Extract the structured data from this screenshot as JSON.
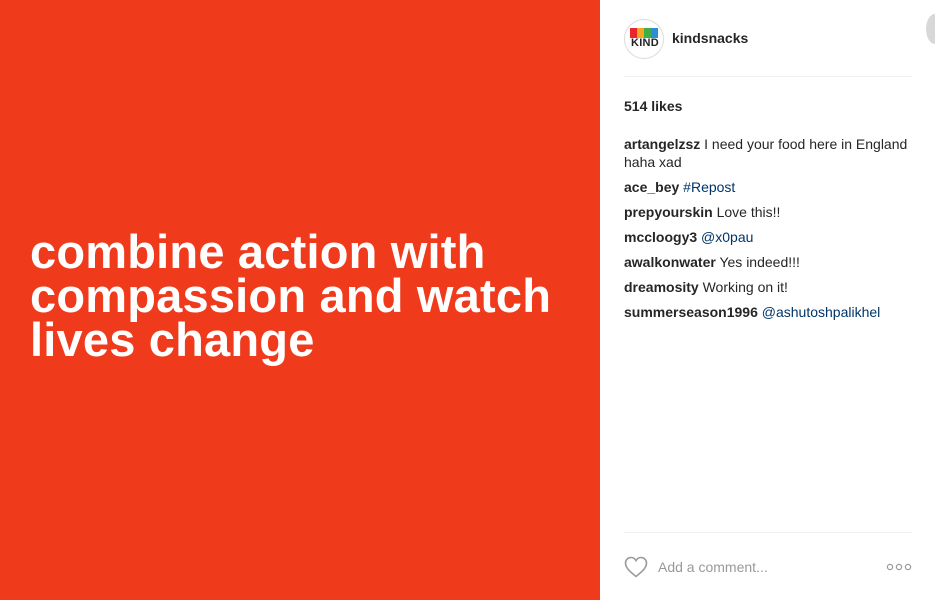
{
  "post": {
    "quote_lines": [
      "combine action with",
      "compassion and watch",
      "lives change"
    ],
    "background_color": "#ef3a1c"
  },
  "header": {
    "username": "kindsnacks",
    "avatar_logo_text": "KIND",
    "avatar_colors": [
      "#e8262b",
      "#f6a623",
      "#3fae49",
      "#2a8fd6"
    ]
  },
  "likes": "514 likes",
  "comments": [
    {
      "author": "artangelzsz",
      "text": "I need your food here in England haha xad",
      "link": ""
    },
    {
      "author": "ace_bey",
      "text": "",
      "link": "#Repost"
    },
    {
      "author": "prepyourskin",
      "text": "Love this!!",
      "link": ""
    },
    {
      "author": "mccloogy3",
      "text": "",
      "link": "@x0pau"
    },
    {
      "author": "awalkonwater",
      "text": "Yes indeed!!!",
      "link": ""
    },
    {
      "author": "dreamosity",
      "text": "Working on it!",
      "link": ""
    },
    {
      "author": "summerseason1996",
      "text": "",
      "link": "@ashutoshpalikhel"
    }
  ],
  "footer": {
    "comment_placeholder": "Add a comment...",
    "heart_icon": "heart-outline",
    "more_icon": "three-dots"
  },
  "colors": {
    "link": "#003569",
    "text": "#262626",
    "placeholder": "#999999"
  }
}
